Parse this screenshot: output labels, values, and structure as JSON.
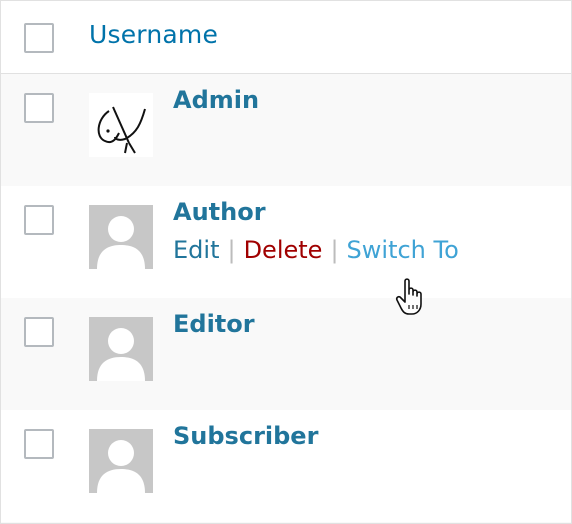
{
  "table": {
    "header": {
      "column_title": "Username"
    },
    "rows": [
      {
        "username": "Admin"
      },
      {
        "username": "Author",
        "actions": {
          "edit": "Edit",
          "delete": "Delete",
          "switch_to": "Switch To",
          "separator": "|"
        }
      },
      {
        "username": "Editor"
      },
      {
        "username": "Subscriber"
      }
    ]
  },
  "colors": {
    "link": "#21759b",
    "delete": "#a00000",
    "switch_hover": "#3fa3d5",
    "avatar_placeholder": "#c7c7c7"
  },
  "icons": {
    "admin_avatar": "sketch-avatar-icon",
    "default_avatar": "default-person-avatar-icon",
    "cursor": "hand-pointer-cursor-icon"
  }
}
